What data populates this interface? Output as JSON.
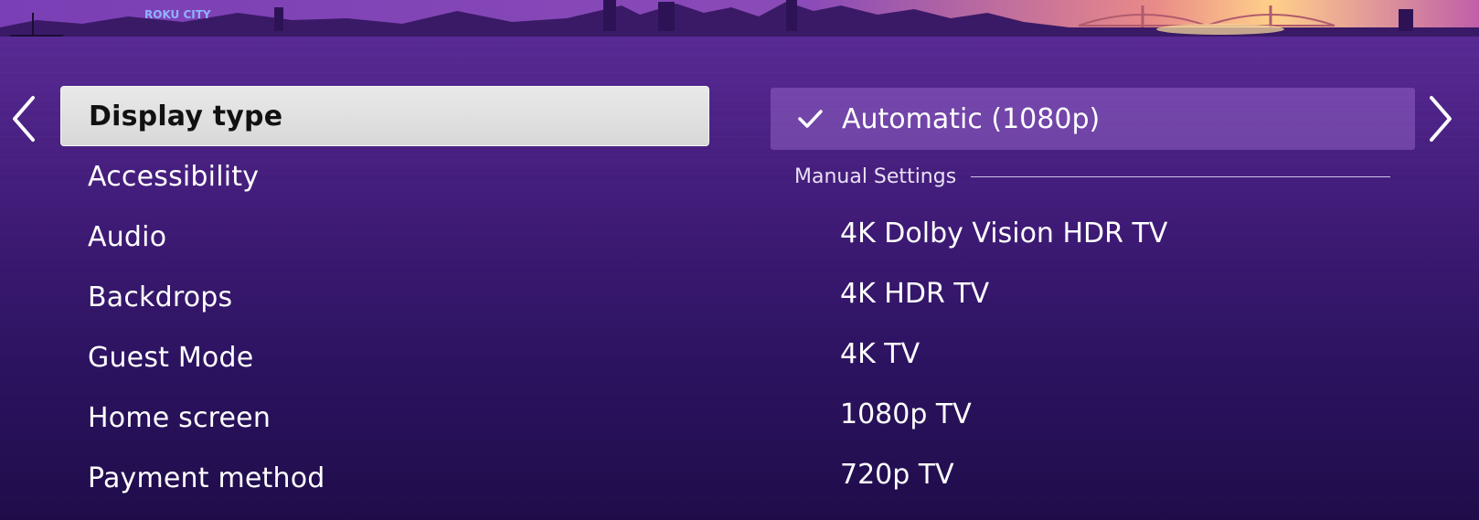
{
  "colors": {
    "accent_purple": "#5d2d9a",
    "selected_item_bg": "#e3e3e3",
    "selected_option_bg": "#8e63c4"
  },
  "skyline": {
    "sign_text": "ROKU CITY"
  },
  "nav": {
    "left_icon": "chevron-left-icon",
    "right_icon": "chevron-right-icon"
  },
  "menu": {
    "items": [
      {
        "label": "Display type",
        "selected": true
      },
      {
        "label": "Accessibility",
        "selected": false
      },
      {
        "label": "Audio",
        "selected": false
      },
      {
        "label": "Backdrops",
        "selected": false
      },
      {
        "label": "Guest Mode",
        "selected": false
      },
      {
        "label": "Home screen",
        "selected": false
      },
      {
        "label": "Payment method",
        "selected": false
      }
    ]
  },
  "display_options": {
    "selected": {
      "label": "Automatic (1080p)",
      "icon": "checkmark-icon"
    },
    "manual_header": "Manual Settings",
    "manual": [
      {
        "label": "4K Dolby Vision HDR TV"
      },
      {
        "label": "4K HDR TV"
      },
      {
        "label": "4K TV"
      },
      {
        "label": "1080p TV"
      },
      {
        "label": "720p TV"
      }
    ]
  }
}
